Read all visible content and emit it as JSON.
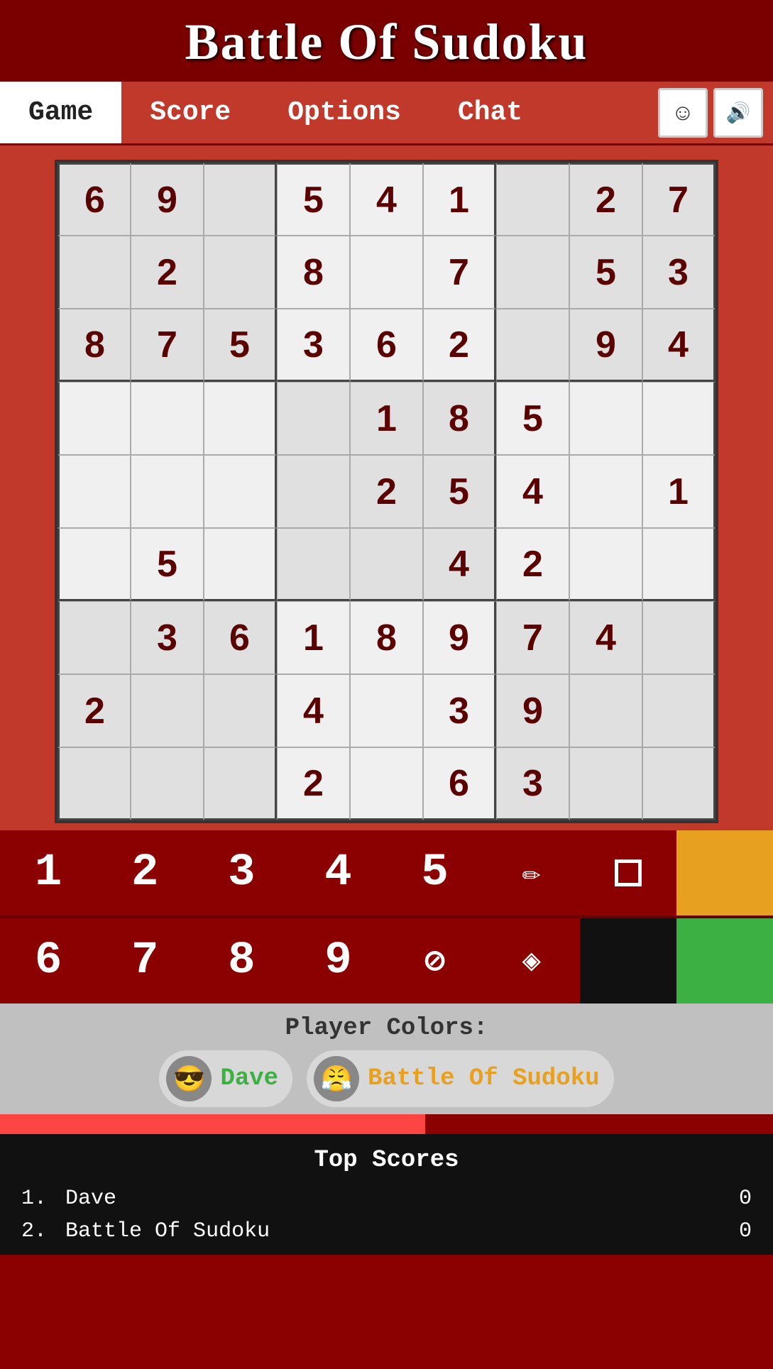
{
  "app": {
    "title": "Battle Of Sudoku"
  },
  "nav": {
    "tabs": [
      {
        "id": "game",
        "label": "Game",
        "active": true
      },
      {
        "id": "score",
        "label": "Score",
        "active": false
      },
      {
        "id": "options",
        "label": "Options",
        "active": false
      },
      {
        "id": "chat",
        "label": "Chat",
        "active": false
      }
    ],
    "smiley_icon": "☺",
    "speaker_icon": "🔊"
  },
  "board": {
    "cells": [
      "6",
      "9",
      "",
      "5",
      "4",
      "1",
      "",
      "2",
      "7",
      "",
      "2",
      "",
      "8",
      "",
      "7",
      "",
      "5",
      "3",
      "8",
      "7",
      "5",
      "3",
      "6",
      "2",
      "",
      "9",
      "4",
      "",
      "",
      "",
      "",
      "1",
      "8",
      "5",
      "",
      "",
      "",
      "",
      "",
      "",
      "2",
      "5",
      "4",
      "",
      "1",
      "",
      "5",
      "",
      "",
      "",
      "4",
      "2",
      "",
      "",
      "",
      "3",
      "6",
      "1",
      "8",
      "9",
      "7",
      "4",
      "",
      "2",
      "",
      "",
      "4",
      "",
      "3",
      "9",
      "",
      "",
      "",
      "",
      "",
      "2",
      "",
      "6",
      "3",
      "",
      ""
    ]
  },
  "numpad": {
    "row1": [
      {
        "type": "number",
        "value": "1"
      },
      {
        "type": "number",
        "value": "2"
      },
      {
        "type": "number",
        "value": "3"
      },
      {
        "type": "number",
        "value": "4"
      },
      {
        "type": "number",
        "value": "5"
      },
      {
        "type": "pencil",
        "value": "✏"
      },
      {
        "type": "square",
        "value": "□"
      },
      {
        "type": "color",
        "value": "",
        "color": "orange"
      }
    ],
    "row2": [
      {
        "type": "number",
        "value": "6"
      },
      {
        "type": "number",
        "value": "7"
      },
      {
        "type": "number",
        "value": "8"
      },
      {
        "type": "number",
        "value": "9"
      },
      {
        "type": "slash",
        "value": "⊘"
      },
      {
        "type": "diamond",
        "value": "◇"
      },
      {
        "type": "color",
        "value": "",
        "color": "black"
      },
      {
        "type": "color",
        "value": "",
        "color": "green"
      }
    ]
  },
  "player_colors": {
    "label": "Player Colors:",
    "players": [
      {
        "name": "Dave",
        "color": "green",
        "avatar": "😎"
      },
      {
        "name": "Battle Of Sudoku",
        "color": "orange",
        "avatar": "😤"
      }
    ]
  },
  "score_bar": {
    "fill_percent": 55
  },
  "top_scores": {
    "title": "Top Scores",
    "entries": [
      {
        "rank": "1.",
        "name": "Dave",
        "score": "0"
      },
      {
        "rank": "2.",
        "name": "Battle Of Sudoku",
        "score": "0"
      }
    ]
  }
}
